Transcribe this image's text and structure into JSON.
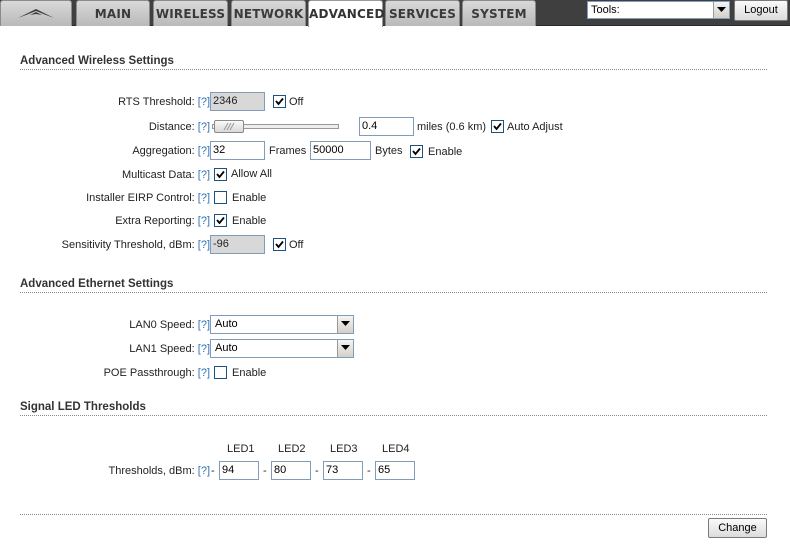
{
  "tabs": {
    "main": "MAIN",
    "wireless": "WIRELESS",
    "network": "NETWORK",
    "advanced": "ADVANCED",
    "services": "SERVICES",
    "system": "SYSTEM"
  },
  "active_tab": "ADVANCED",
  "tools": {
    "selected": "Tools:"
  },
  "logout_label": "Logout",
  "help": "[?]",
  "wireless": {
    "title": "Advanced Wireless Settings",
    "rts": {
      "label": "RTS Threshold:",
      "value": "2346",
      "off_label": "Off",
      "off_checked": true
    },
    "distance": {
      "label": "Distance:",
      "value": "0.4",
      "unit_text": "miles (0.6 km)",
      "auto_label": "Auto Adjust",
      "auto_checked": true,
      "slider_fraction": 0.02
    },
    "aggregation": {
      "label": "Aggregation:",
      "frames_value": "32",
      "frames_label": "Frames",
      "bytes_value": "50000",
      "bytes_label": "Bytes",
      "enable_label": "Enable",
      "enable_checked": true
    },
    "multicast": {
      "label": "Multicast Data:",
      "option_label": "Allow All",
      "checked": true
    },
    "eirp": {
      "label": "Installer EIRP Control:",
      "option_label": "Enable",
      "checked": false
    },
    "extra_reporting": {
      "label": "Extra Reporting:",
      "option_label": "Enable",
      "checked": true
    },
    "sensitivity": {
      "label": "Sensitivity Threshold, dBm:",
      "value": "-96",
      "off_label": "Off",
      "off_checked": true
    }
  },
  "ethernet": {
    "title": "Advanced Ethernet Settings",
    "lan0": {
      "label": "LAN0 Speed:",
      "value": "Auto"
    },
    "lan1": {
      "label": "LAN1 Speed:",
      "value": "Auto"
    },
    "poe": {
      "label": "POE Passthrough:",
      "option_label": "Enable",
      "checked": false
    }
  },
  "led": {
    "title": "Signal LED Thresholds",
    "row_label": "Thresholds, dBm:",
    "dash": "-",
    "headers": [
      "LED1",
      "LED2",
      "LED3",
      "LED4"
    ],
    "values": [
      "94",
      "80",
      "73",
      "65"
    ]
  },
  "change_label": "Change",
  "colors": {
    "topbar": "#3f3f3f",
    "help_link": "#2e73b8",
    "input_border": "#7f9db9"
  }
}
